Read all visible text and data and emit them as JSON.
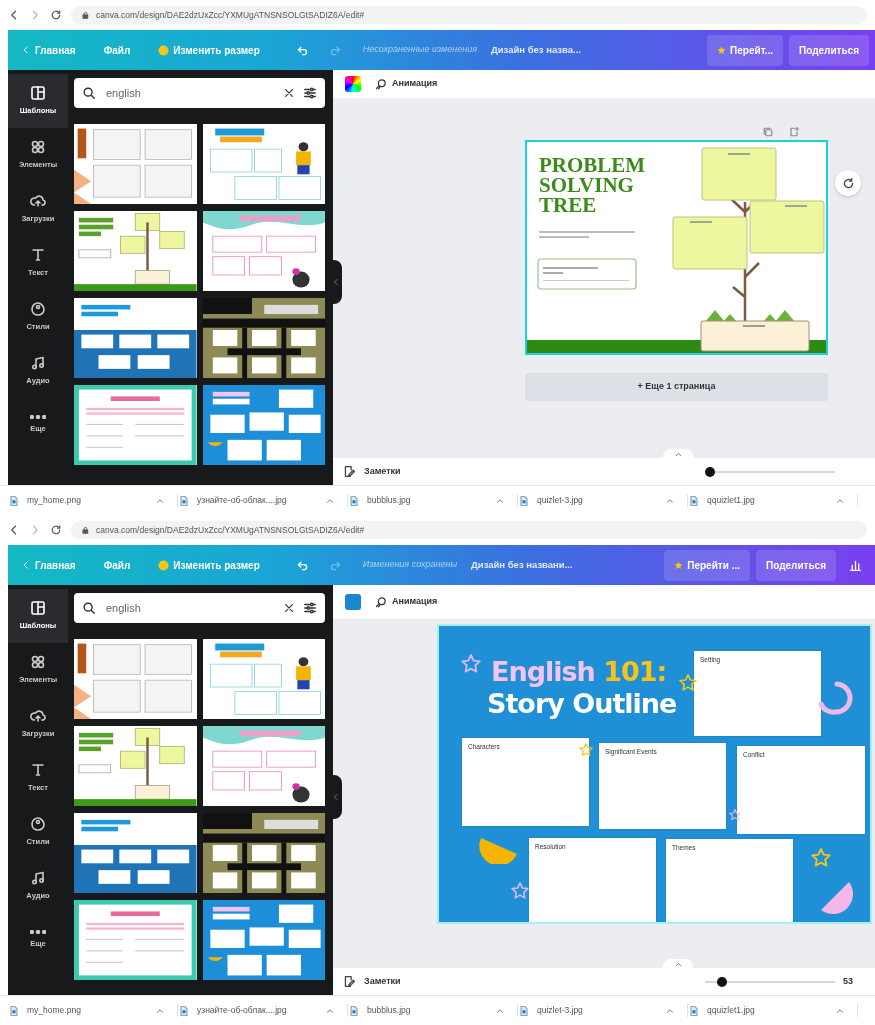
{
  "screens": [
    {
      "address_bar": {
        "url": "canva.com/design/DAE2dzUxZcc/YXMUgATNSNSOLGtSADIZ6A/edit#"
      },
      "header": {
        "home": "Главная",
        "file": "Файл",
        "resize": "Изменить размер",
        "save_status": "Несохраненные изменения",
        "title": "Дизайн без назва...",
        "upgrade": "Перейт...",
        "share": "Поделиться",
        "stats_button": false
      },
      "sidebar": [
        {
          "label": "Шаблоны",
          "selected": true
        },
        {
          "label": "Элементы",
          "selected": false
        },
        {
          "label": "Загрузки",
          "selected": false
        },
        {
          "label": "Текст",
          "selected": false
        },
        {
          "label": "Стили",
          "selected": false
        },
        {
          "label": "Аудио",
          "selected": false
        },
        {
          "label": "Еще",
          "selected": false
        }
      ],
      "search": {
        "value": "english"
      },
      "templates": [
        {
          "kind": "reading"
        },
        {
          "kind": "comic"
        },
        {
          "kind": "tree"
        },
        {
          "kind": "plan"
        },
        {
          "kind": "review"
        },
        {
          "kind": "dark"
        },
        {
          "kind": "essay"
        },
        {
          "kind": "story"
        }
      ],
      "toolbar": {
        "swatch": {
          "kind": "gradient"
        },
        "animation": "Анимация"
      },
      "page_actions": true,
      "design": {
        "kind": "tree",
        "title": "PROBLEM SOLVING TREE"
      },
      "more_pages": "+ Еще 1 страница",
      "notes": "Заметки",
      "zoom": {
        "level": 0.0
      },
      "downloads": [
        "my_home.png",
        "узнайте-об-облак....jpg",
        "bubblus.jpg",
        "quizlet-3.jpg",
        "qquizlet1.jpg"
      ]
    },
    {
      "address_bar": {
        "url": "canva.com/design/DAE2dzUxZcc/YXMUgATNSNSOLGtSADIZ6A/edit#"
      },
      "header": {
        "home": "Главная",
        "file": "Файл",
        "resize": "Изменить размер",
        "save_status": "Изменения сохранены",
        "title": "Дизайн без названи...",
        "upgrade": "Перейти ...",
        "share": "Поделиться",
        "stats_button": true
      },
      "sidebar": [
        {
          "label": "Шаблоны",
          "selected": true
        },
        {
          "label": "Элементы",
          "selected": false
        },
        {
          "label": "Загрузки",
          "selected": false
        },
        {
          "label": "Текст",
          "selected": false
        },
        {
          "label": "Стили",
          "selected": false
        },
        {
          "label": "Аудио",
          "selected": false
        },
        {
          "label": "Еще",
          "selected": false
        }
      ],
      "search": {
        "value": "english"
      },
      "templates": [
        {
          "kind": "reading"
        },
        {
          "kind": "comic"
        },
        {
          "kind": "tree"
        },
        {
          "kind": "plan"
        },
        {
          "kind": "review"
        },
        {
          "kind": "dark"
        },
        {
          "kind": "essay"
        },
        {
          "kind": "story"
        }
      ],
      "toolbar": {
        "swatch": {
          "kind": "solid"
        },
        "animation": "Анимация"
      },
      "page_actions": false,
      "design": {
        "kind": "story",
        "title": "English **101:**",
        "subtitle": "Story Outline",
        "boxes": [
          {
            "label": "Setting"
          },
          {
            "label": "Characters"
          },
          {
            "label": "Significant Events"
          },
          {
            "label": "Conflict"
          },
          {
            "label": "Resolution"
          },
          {
            "label": "Themes"
          }
        ]
      },
      "notes": "Заметки",
      "zoom": {
        "level": 0.1,
        "reading": "53"
      },
      "downloads": [
        "my_home.png",
        "узнайте-об-облак....jpg",
        "bubblus.jpg",
        "quizlet-3.jpg",
        "qquizlet1.jpg"
      ]
    }
  ]
}
